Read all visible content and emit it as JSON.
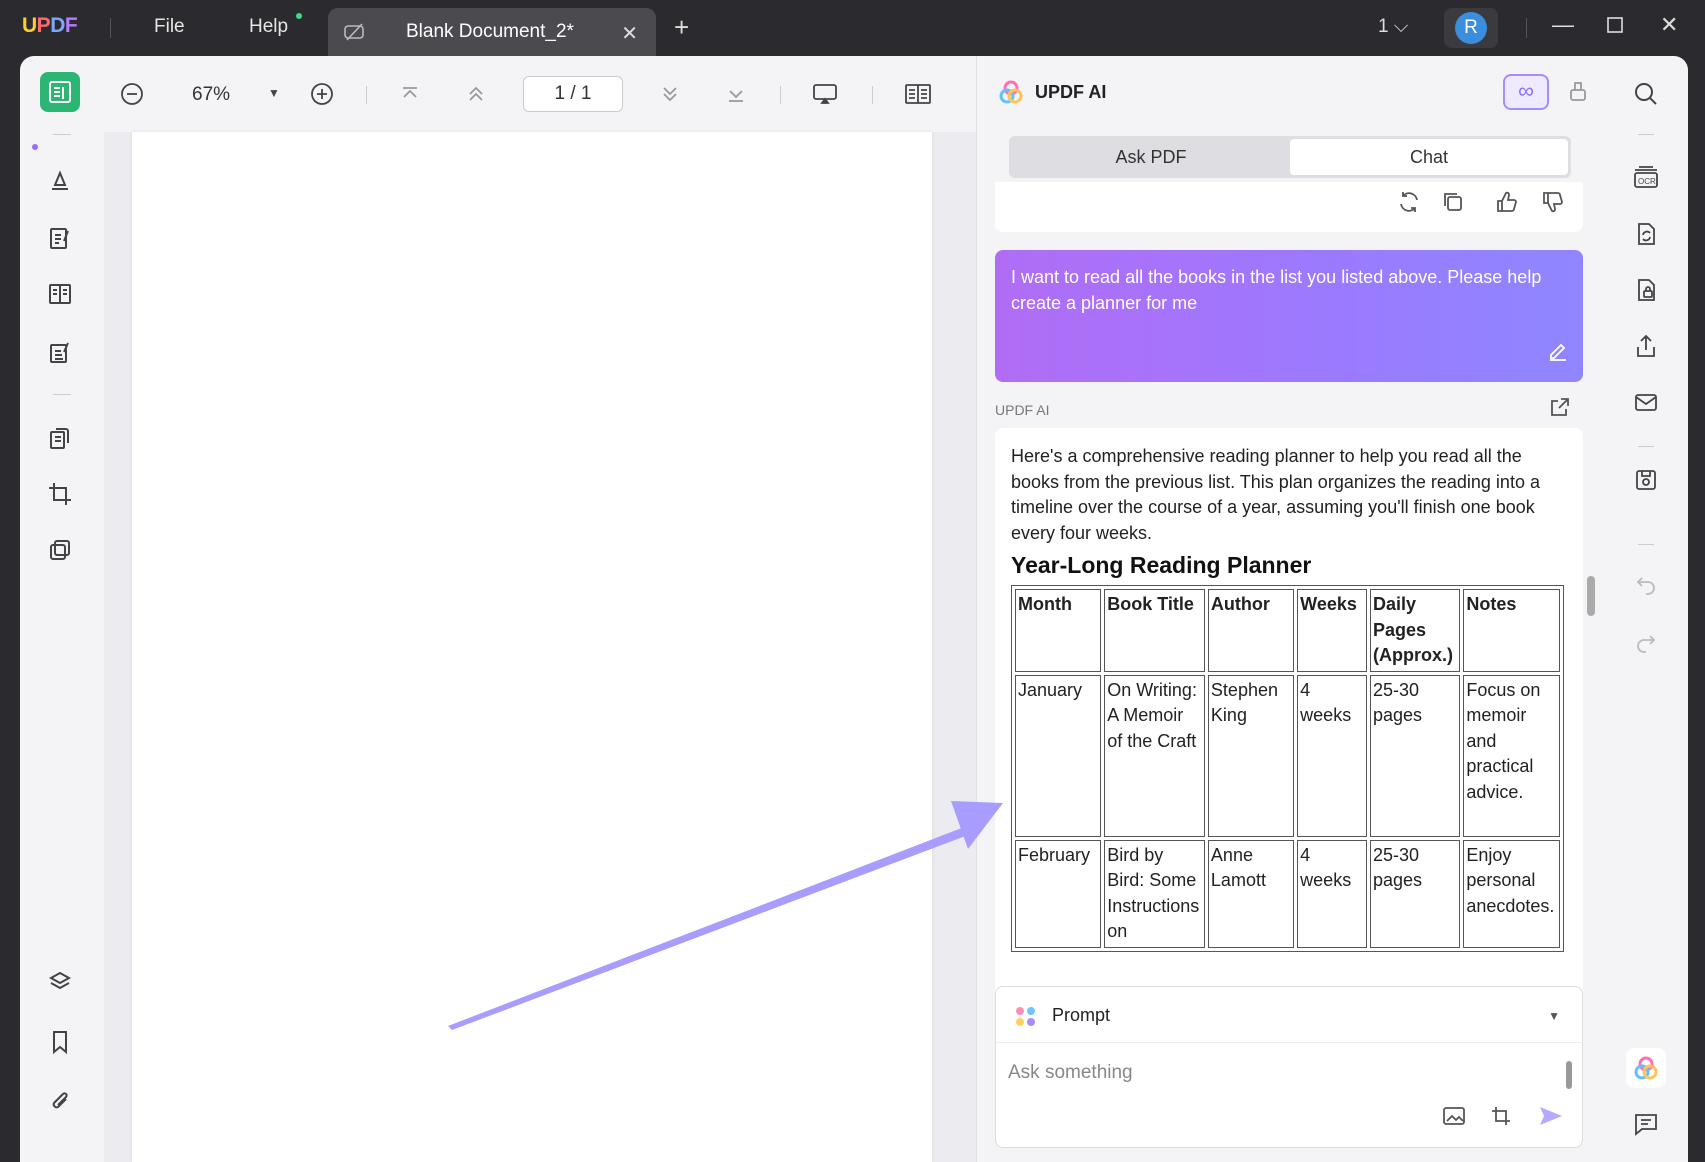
{
  "app": {
    "logo": {
      "u": "U",
      "p": "P",
      "d": "D",
      "f": "F"
    },
    "menu": [
      "File",
      "Help"
    ],
    "tab_title": "Blank Document_2*",
    "page_count_label": "1",
    "avatar_initial": "R"
  },
  "toolbar": {
    "zoom": "67%",
    "page_indicator": "1  /  1"
  },
  "ai": {
    "title": "UPDF AI",
    "tabs": [
      "Ask PDF",
      "Chat"
    ],
    "selected_tab": "Chat",
    "user_message": "I want to read all the books in the list you listed above. Please help create a planner for me",
    "ai_label": "UPDF AI",
    "intro": "Here's a comprehensive reading planner to help you read all the books from the previous list. This plan organizes the reading into a timeline over the course of a year, assuming you'll finish one book every four weeks.",
    "heading": "Year-Long Reading Planner",
    "table": {
      "headers": [
        "Month",
        "Book Title",
        "Author",
        "Weeks",
        "Daily Pages (Approx.)",
        "Notes"
      ],
      "rows": [
        [
          "January",
          "On Writing: A Memoir of the Craft",
          "Stephen King",
          "4 weeks",
          "25-30 pages",
          "Focus on memoir and practical advice."
        ],
        [
          "February",
          "Bird by Bird: Some Instructions on",
          "Anne Lamott",
          "4 weeks",
          "25-30 pages",
          "Enjoy personal anecdotes."
        ]
      ]
    },
    "prompt_label": "Prompt",
    "ask_placeholder": "Ask something"
  },
  "colors": {
    "accent_green": "#2bb673",
    "accent_purple": "#9a7bff",
    "arrow": "#a89cff"
  }
}
